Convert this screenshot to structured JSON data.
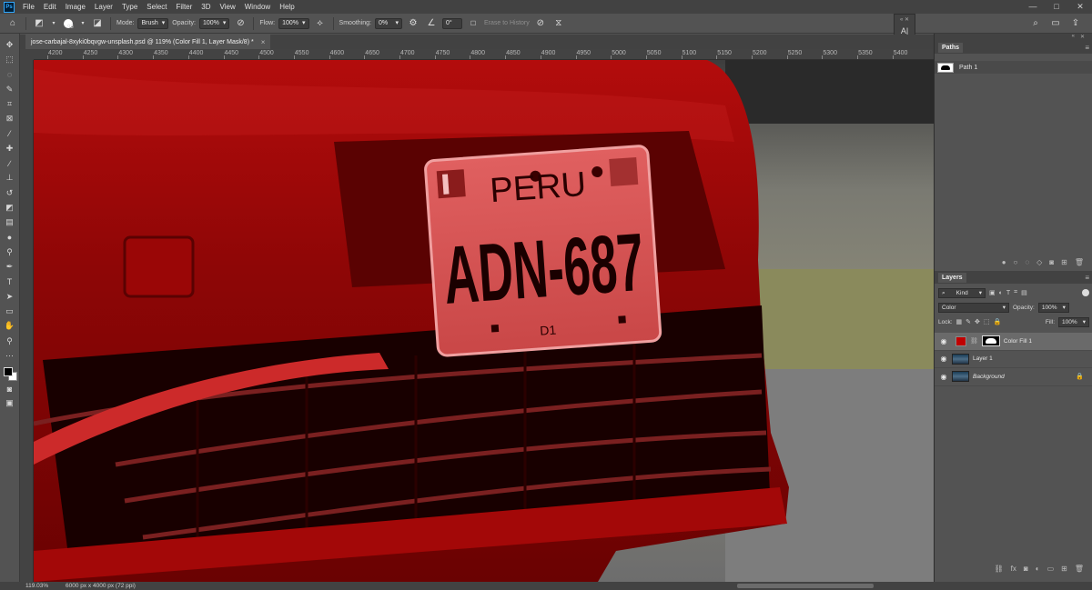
{
  "app": {
    "logo": "Ps"
  },
  "menu": [
    "File",
    "Edit",
    "Image",
    "Layer",
    "Type",
    "Select",
    "Filter",
    "3D",
    "View",
    "Window",
    "Help"
  ],
  "window_controls": {
    "minimize": "—",
    "maximize": "□",
    "close": "✕"
  },
  "options": {
    "brush_size": "98",
    "mode_label": "Mode:",
    "mode_value": "Brush",
    "opacity_label": "Opacity:",
    "opacity_value": "100%",
    "flow_label": "Flow:",
    "flow_value": "100%",
    "smoothing_label": "Smoothing:",
    "smoothing_value": "0%",
    "angle_value": "0°",
    "erase_history": "Erase to History"
  },
  "document_tab": {
    "title": "jose-carbajal-8xyki0bqvgw-unsplash.psd @ 119% (Color Fill 1, Layer Mask/8) *",
    "close": "×"
  },
  "ruler_top": [
    "4200",
    "4250",
    "4300",
    "4350",
    "4400",
    "4450",
    "4500",
    "4550",
    "4600",
    "4650",
    "4700",
    "4750",
    "4800",
    "4850",
    "4900",
    "4950",
    "5000",
    "5050",
    "5100",
    "5150",
    "5200",
    "5250",
    "5300",
    "5350",
    "5400"
  ],
  "canvas": {
    "plate_country": "PERU",
    "plate_number": "ADN-687",
    "plate_code": "D1"
  },
  "paths_panel": {
    "tab": "Paths",
    "items": [
      {
        "name": "Path 1"
      }
    ]
  },
  "layers_panel": {
    "tab": "Layers",
    "kind_label": "Kind",
    "blend_mode": "Color",
    "opacity_label": "Opacity:",
    "opacity_value": "100%",
    "lock_label": "Lock:",
    "fill_label": "Fill:",
    "fill_value": "100%",
    "layers": [
      {
        "name": "Color Fill 1",
        "active": true
      },
      {
        "name": "Layer 1",
        "active": false
      },
      {
        "name": "Background",
        "active": false,
        "locked": true
      }
    ]
  },
  "status": {
    "zoom": "119.03%",
    "doc_size": "6000 px x 4000 px (72 ppi)"
  },
  "colors": {
    "fill_red": "#c00000",
    "ui_dark": "#424242",
    "ui_mid": "#535353"
  }
}
